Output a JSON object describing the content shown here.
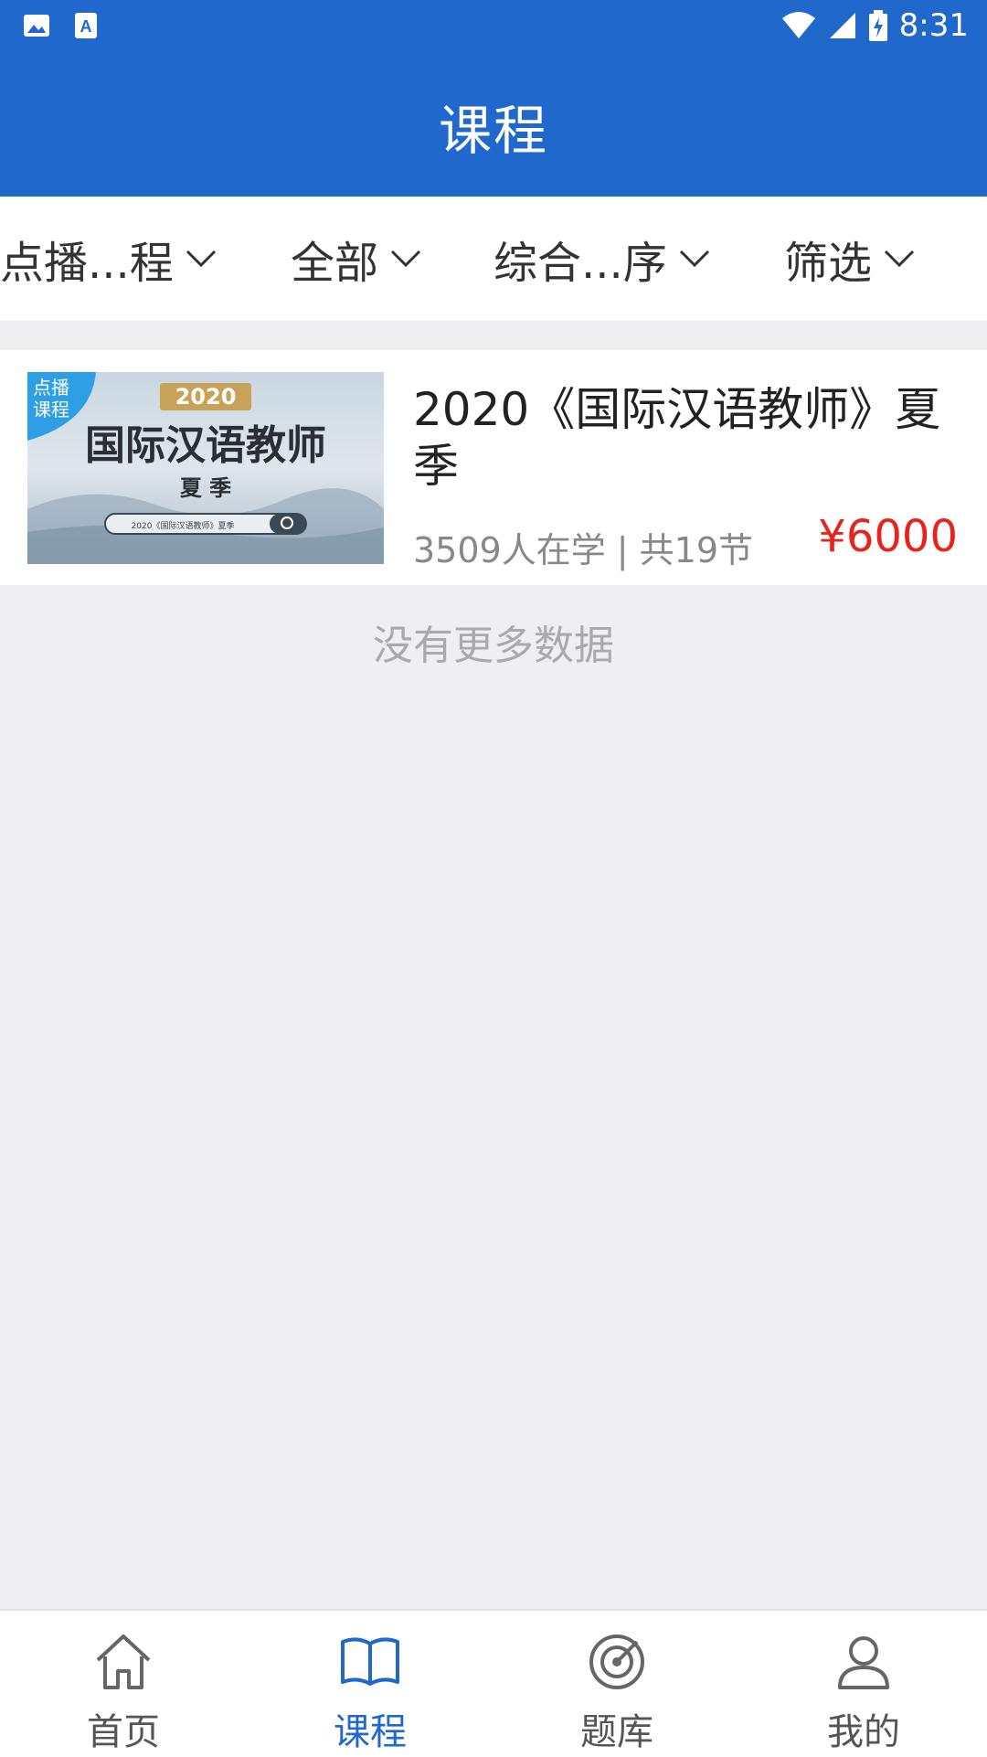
{
  "status_bar": {
    "time": "8:31"
  },
  "header": {
    "title": "课程"
  },
  "filters": [
    {
      "label": "点播...程"
    },
    {
      "label": "全部"
    },
    {
      "label": "综合...序"
    },
    {
      "label": "筛选"
    }
  ],
  "course": {
    "thumbnail": {
      "badge_line1": "点播",
      "badge_line2": "课程",
      "year": "2020",
      "title": "国际汉语教师",
      "subtitle": "夏 季",
      "search_text": "2020《国际汉语教师》夏季"
    },
    "title": "2020《国际汉语教师》夏季",
    "meta": "3509人在学 | 共19节",
    "price": "¥6000"
  },
  "list_end_text": "没有更多数据",
  "bottom_nav": [
    {
      "label": "首页",
      "icon": "home-icon",
      "active": false
    },
    {
      "label": "课程",
      "icon": "book-icon",
      "active": true
    },
    {
      "label": "题库",
      "icon": "target-icon",
      "active": false
    },
    {
      "label": "我的",
      "icon": "user-icon",
      "active": false
    }
  ],
  "colors": {
    "primary": "#2168cd",
    "price": "#e8231c",
    "background": "#efeef1"
  }
}
